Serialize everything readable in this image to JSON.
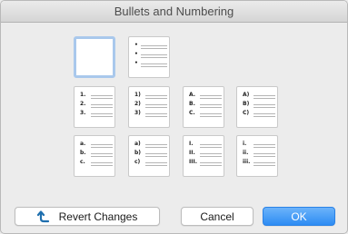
{
  "window": {
    "title": "Bullets and Numbering"
  },
  "styles": [
    {
      "id": "none",
      "markers": []
    },
    {
      "id": "bullet",
      "markers": [
        "•",
        "•",
        "•"
      ]
    },
    {
      "id": "number-dot",
      "markers": [
        "1.",
        "2.",
        "3."
      ]
    },
    {
      "id": "number-paren",
      "markers": [
        "1)",
        "2)",
        "3)"
      ]
    },
    {
      "id": "upper-alpha-dot",
      "markers": [
        "A.",
        "B.",
        "C."
      ]
    },
    {
      "id": "upper-alpha-paren",
      "markers": [
        "A)",
        "B)",
        "C)"
      ]
    },
    {
      "id": "lower-alpha-dot",
      "markers": [
        "a.",
        "b.",
        "c."
      ]
    },
    {
      "id": "lower-alpha-paren",
      "markers": [
        "a)",
        "b)",
        "c)"
      ]
    },
    {
      "id": "upper-roman-dot",
      "markers": [
        "I.",
        "II.",
        "III."
      ]
    },
    {
      "id": "lower-roman-dot",
      "markers": [
        "i.",
        "ii.",
        "iii."
      ]
    }
  ],
  "buttons": {
    "revert_label": "Revert Changes",
    "cancel_label": "Cancel",
    "ok_label": "OK"
  },
  "colors": {
    "accent": "#2d8cf3",
    "selection": "#a9c8ec"
  },
  "icons": {
    "revert": "revert-arrow-icon"
  }
}
